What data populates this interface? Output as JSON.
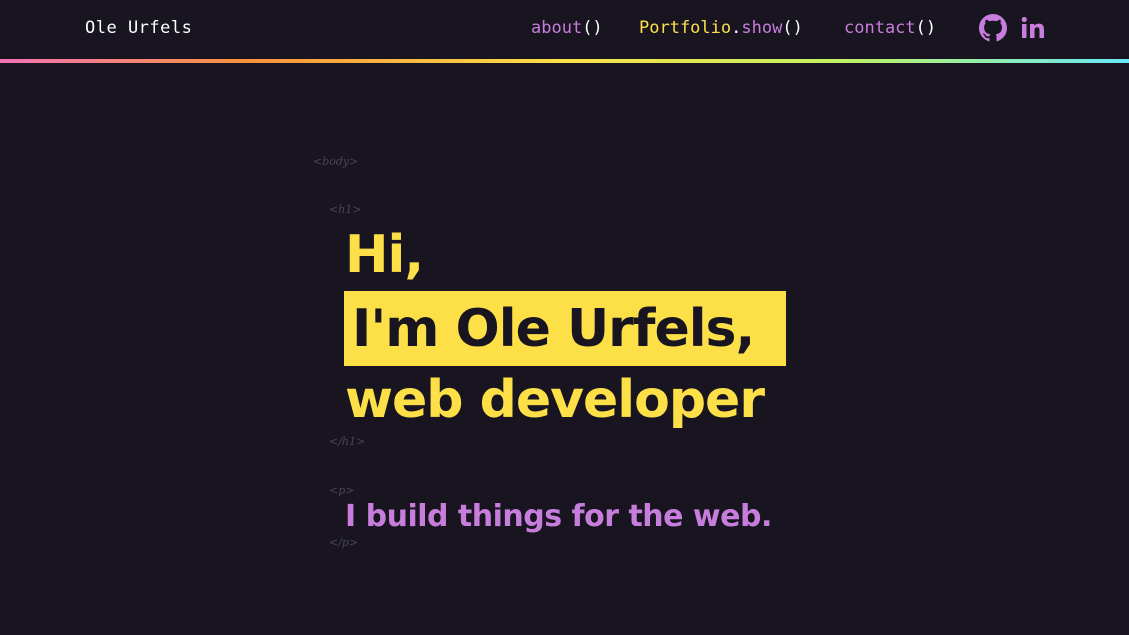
{
  "header": {
    "brand": "Ole Urfels",
    "nav": {
      "about": {
        "name": "about",
        "parens": "()"
      },
      "portfolio": {
        "object": "Portfolio",
        "dot": ".",
        "method": "show",
        "parens": "()"
      },
      "contact": {
        "name": "contact",
        "parens": "()"
      }
    },
    "icons": [
      "github-icon",
      "linkedin-icon"
    ],
    "gradient_colors": [
      "#f472b6",
      "#fb923c",
      "#fde047",
      "#bef264",
      "#67e8f9"
    ]
  },
  "decor_tags": {
    "body_open": "<body>",
    "h1_open": "<h1>",
    "h1_close": "</h1>",
    "p_open": "<p>",
    "p_close": "</p>"
  },
  "hero": {
    "greeting": "Hi,",
    "name_line": "I'm Ole Urfels,",
    "role_line": "web developer",
    "tagline": "I build things for the web."
  },
  "colors": {
    "background": "#181520",
    "accent_yellow": "#fde047",
    "accent_purple": "#c77ddb"
  }
}
